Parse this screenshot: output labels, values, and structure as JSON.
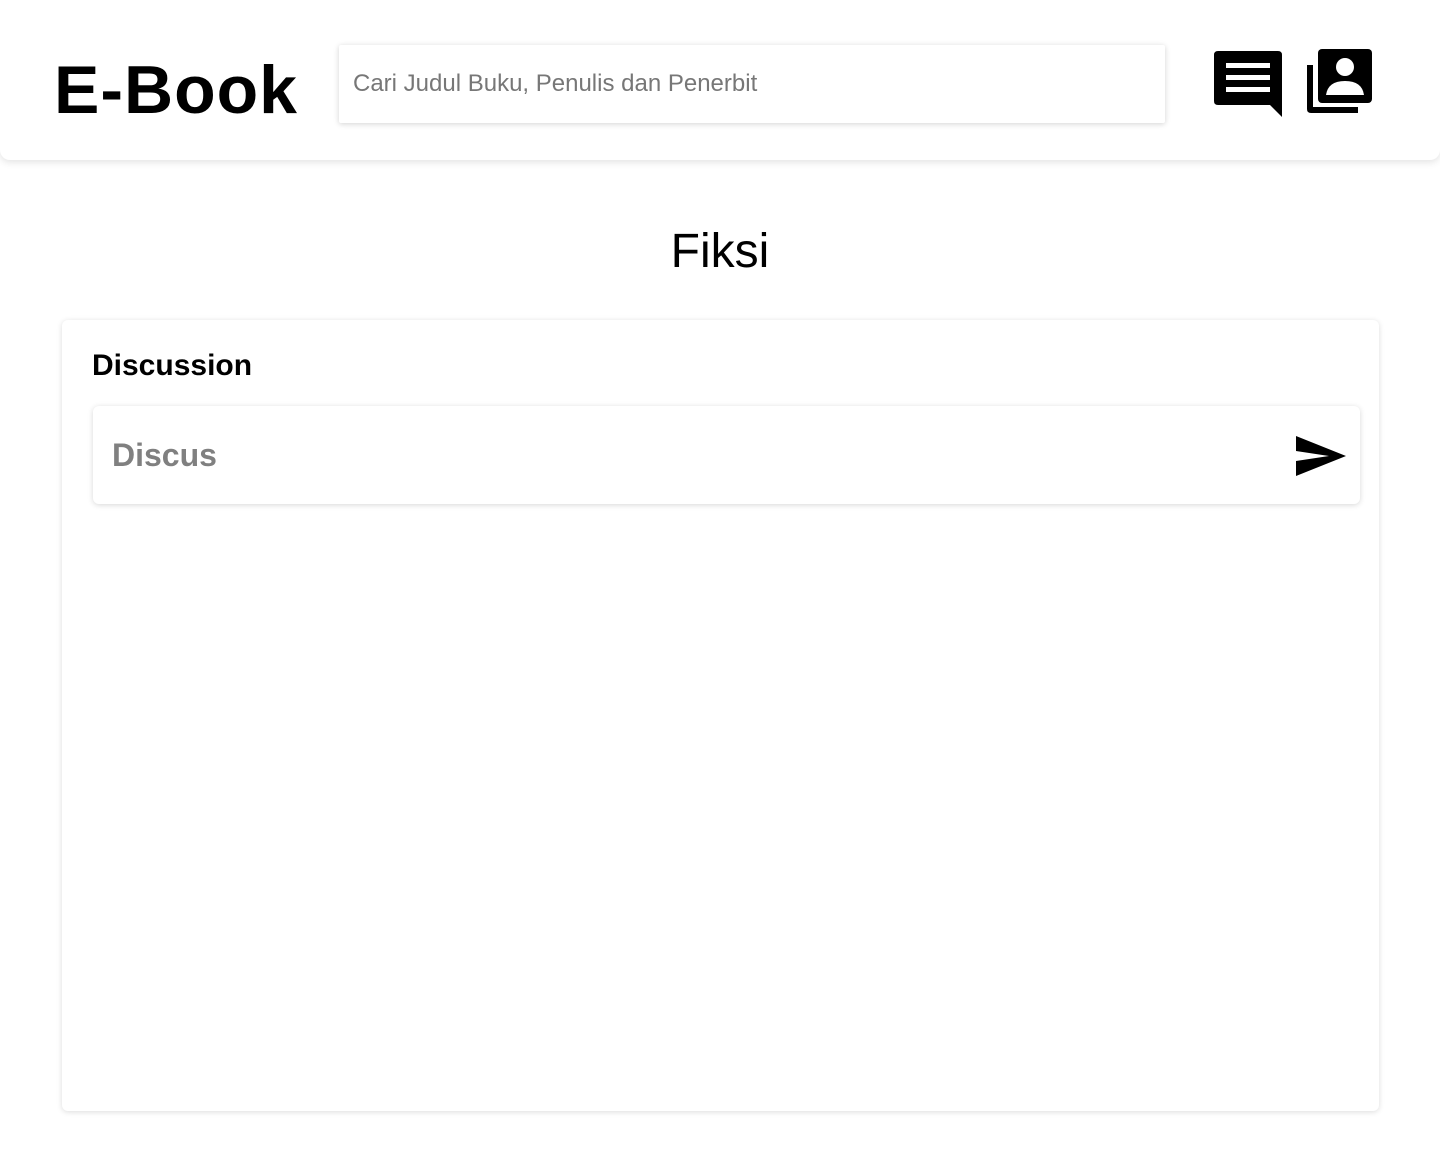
{
  "header": {
    "logo": "E-Book",
    "search": {
      "placeholder": "Cari Judul Buku, Penulis dan Penerbit",
      "value": ""
    },
    "icons": [
      "chat-icon",
      "library-icon"
    ]
  },
  "page": {
    "title": "Fiksi"
  },
  "discussion": {
    "heading": "Discussion",
    "input": {
      "placeholder": "Discus",
      "value": ""
    },
    "send_icon": "send-icon"
  },
  "colors": {
    "background": "#ffffff",
    "text": "#000000",
    "placeholder": "#808080"
  }
}
